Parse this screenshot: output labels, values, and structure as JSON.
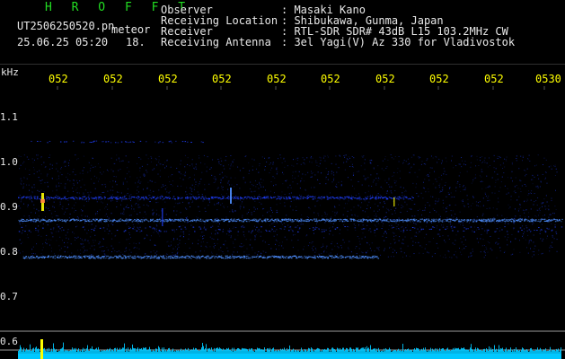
{
  "header": {
    "app_title": "H R O F F T",
    "filename": "UT2506250520.pn",
    "mode": "meteor",
    "date_time": "25.06.25 05:20",
    "count": "18.",
    "info_labels": [
      "Observer",
      "Receiving Location",
      "Receiver",
      "Receiving Antenna"
    ],
    "info_values": [
      ": Masaki Kano",
      ": Shibukawa, Gunma, Japan",
      ": RTL-SDR SDR# 43dB L15 103.2MHz CW",
      ": 3el Yagi(V) Az 330 for Vladivostok"
    ]
  },
  "spectrogram": {
    "freq_unit": "kHz",
    "time_tick_labels": [
      "052",
      "052",
      "052",
      "052",
      "052",
      "052",
      "052",
      "052",
      "052",
      "0530"
    ],
    "freq_tick_labels": [
      "1.1",
      "1.0",
      "0.9",
      "0.8",
      "0.7",
      "0.6"
    ],
    "colors": {
      "background": "#000000",
      "signal": "#2040ff",
      "signal_bright": "#5090ff",
      "meteor": "#ffff00",
      "noise_bar": "#00c8ff",
      "axis": "#ffffff"
    }
  }
}
